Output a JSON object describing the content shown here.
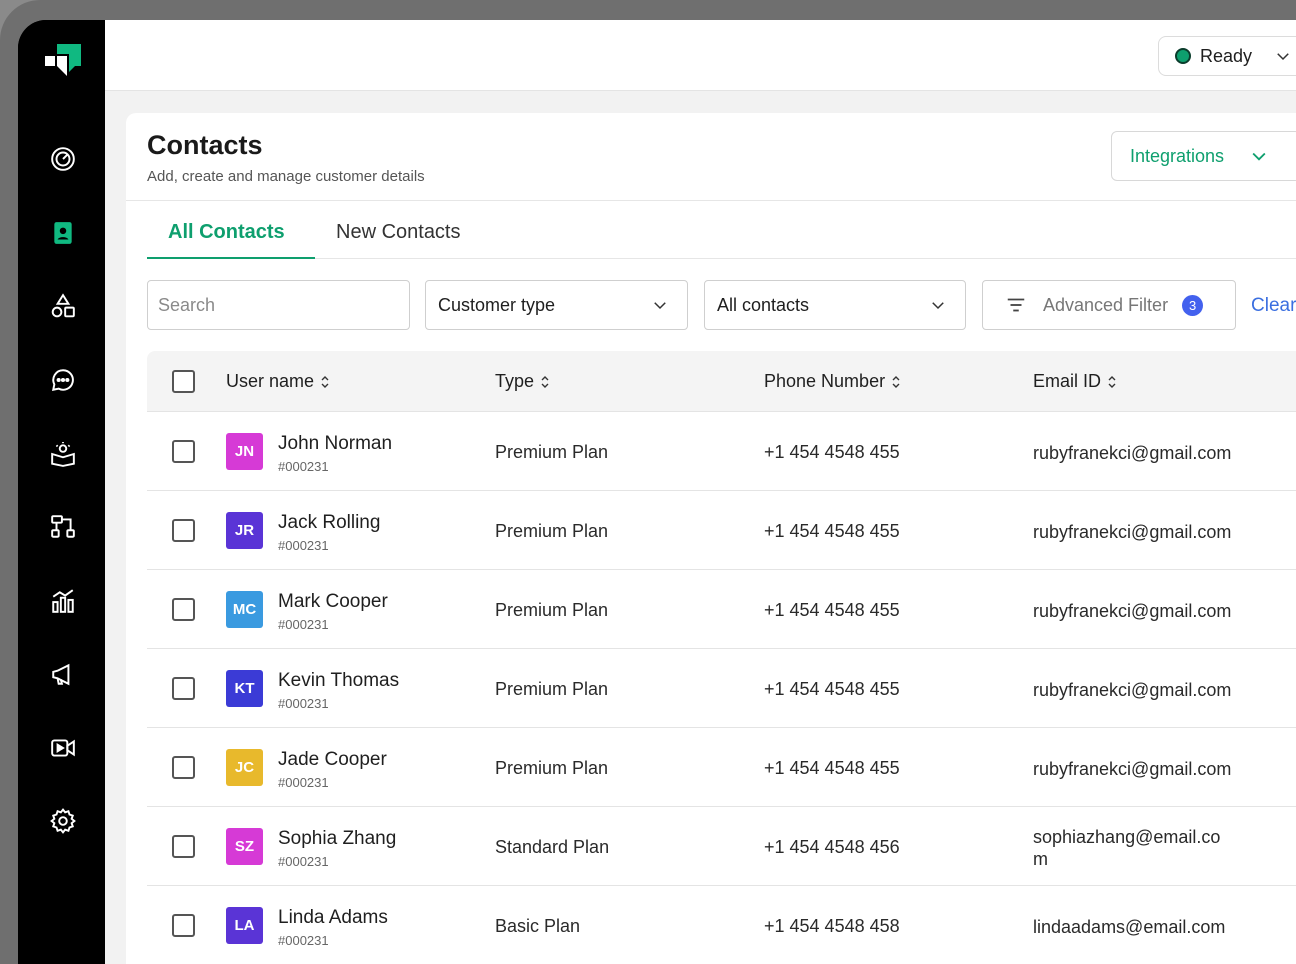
{
  "status": {
    "label": "Ready",
    "color": "#0e9f6e"
  },
  "header": {
    "title": "Contacts",
    "subtitle": "Add, create and manage customer details",
    "integrations_label": "Integrations"
  },
  "tabs": [
    {
      "label": "All Contacts",
      "active": true
    },
    {
      "label": "New Contacts",
      "active": false
    }
  ],
  "filters": {
    "search_placeholder": "Search",
    "customer_type": "Customer type",
    "contacts_scope": "All contacts",
    "advanced_label": "Advanced Filter",
    "advanced_count": "3",
    "clear_label": "Clear"
  },
  "table": {
    "columns": [
      "User name",
      "Type",
      "Phone Number",
      "Email ID"
    ],
    "rows": [
      {
        "initials": "JN",
        "color": "#d63ad6",
        "name": "John Norman",
        "id": "#000231",
        "type": "Premium Plan",
        "phone": "+1 454 4548 455",
        "email": "rubyfranekci@gmail.com"
      },
      {
        "initials": "JR",
        "color": "#5a34d6",
        "name": "Jack Rolling",
        "id": "#000231",
        "type": "Premium Plan",
        "phone": "+1 454 4548 455",
        "email": "rubyfranekci@gmail.com"
      },
      {
        "initials": "MC",
        "color": "#3a9ae0",
        "name": "Mark Cooper",
        "id": "#000231",
        "type": "Premium Plan",
        "phone": "+1 454 4548 455",
        "email": "rubyfranekci@gmail.com"
      },
      {
        "initials": "KT",
        "color": "#3b3bd6",
        "name": "Kevin Thomas",
        "id": "#000231",
        "type": "Premium Plan",
        "phone": "+1 454 4548 455",
        "email": "rubyfranekci@gmail.com"
      },
      {
        "initials": "JC",
        "color": "#e8b92c",
        "name": "Jade Cooper",
        "id": "#000231",
        "type": "Premium Plan",
        "phone": "+1 454 4548 455",
        "email": "rubyfranekci@gmail.com"
      },
      {
        "initials": "SZ",
        "color": "#d63ad6",
        "name": "Sophia Zhang",
        "id": "#000231",
        "type": "Standard Plan",
        "phone": "+1 454 4548 456",
        "email": "sophiazhang@email.com"
      },
      {
        "initials": "LA",
        "color": "#5a34d6",
        "name": "Linda Adams",
        "id": "#000231",
        "type": "Basic Plan",
        "phone": "+1 454 4548 458",
        "email": "lindaadams@email.com"
      }
    ]
  }
}
